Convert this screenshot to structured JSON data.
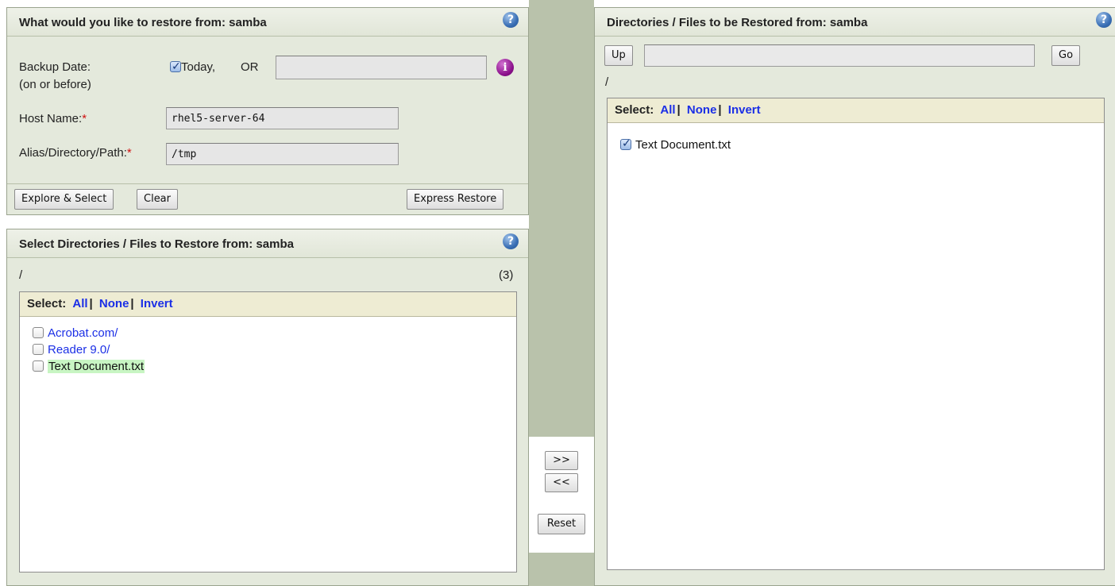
{
  "restore_from_panel": {
    "title": "What would you like to restore from: samba",
    "help_icon": "?",
    "backup_date_label": "Backup Date:",
    "backup_date_sub": "(on or before)",
    "today_label": "Today,",
    "or_label": "OR",
    "date_value": "",
    "info_icon": "i",
    "host_label": "Host Name:",
    "host_value": "rhel5-server-64",
    "path_label": "Alias/Directory/Path:",
    "path_value": "/tmp",
    "required_mark": "*",
    "explore_button": "Explore & Select",
    "clear_button": "Clear",
    "express_button": "Express Restore"
  },
  "select_panel": {
    "title": "Select Directories / Files to Restore from: samba",
    "help_icon": "?",
    "path": "/",
    "count": "(3)",
    "select_label": "Select:",
    "all": "All",
    "none": "None",
    "invert": "Invert",
    "separator": "|",
    "items": [
      {
        "name": "Acrobat.com/",
        "checked": false
      },
      {
        "name": "Reader 9.0/",
        "checked": false
      },
      {
        "name": "Text Document.txt",
        "checked": false
      }
    ]
  },
  "transfer": {
    "add_button": ">>",
    "remove_button": "<<",
    "reset_button": "Reset"
  },
  "restored_panel": {
    "title": "Directories / Files to be Restored from: samba",
    "help_icon": "?",
    "up_button": "Up",
    "path_input_value": "",
    "go_button": "Go",
    "path": "/",
    "select_label": "Select:",
    "all": "All",
    "none": "None",
    "invert": "Invert",
    "separator": "|",
    "items": [
      {
        "name": "Text Document.txt",
        "checked": true
      }
    ]
  },
  "colors": {
    "panel_bg": "#e4e9dc",
    "link_blue": "#1b2fe6",
    "required_red": "#d01010",
    "select_bar_bg": "#eeecd3",
    "highlight_green": "#c8f5c3",
    "divider_bg": "#b9c2ab"
  },
  "icons": {
    "help": "help-icon",
    "info": "info-icon",
    "checkbox": "checkbox"
  }
}
